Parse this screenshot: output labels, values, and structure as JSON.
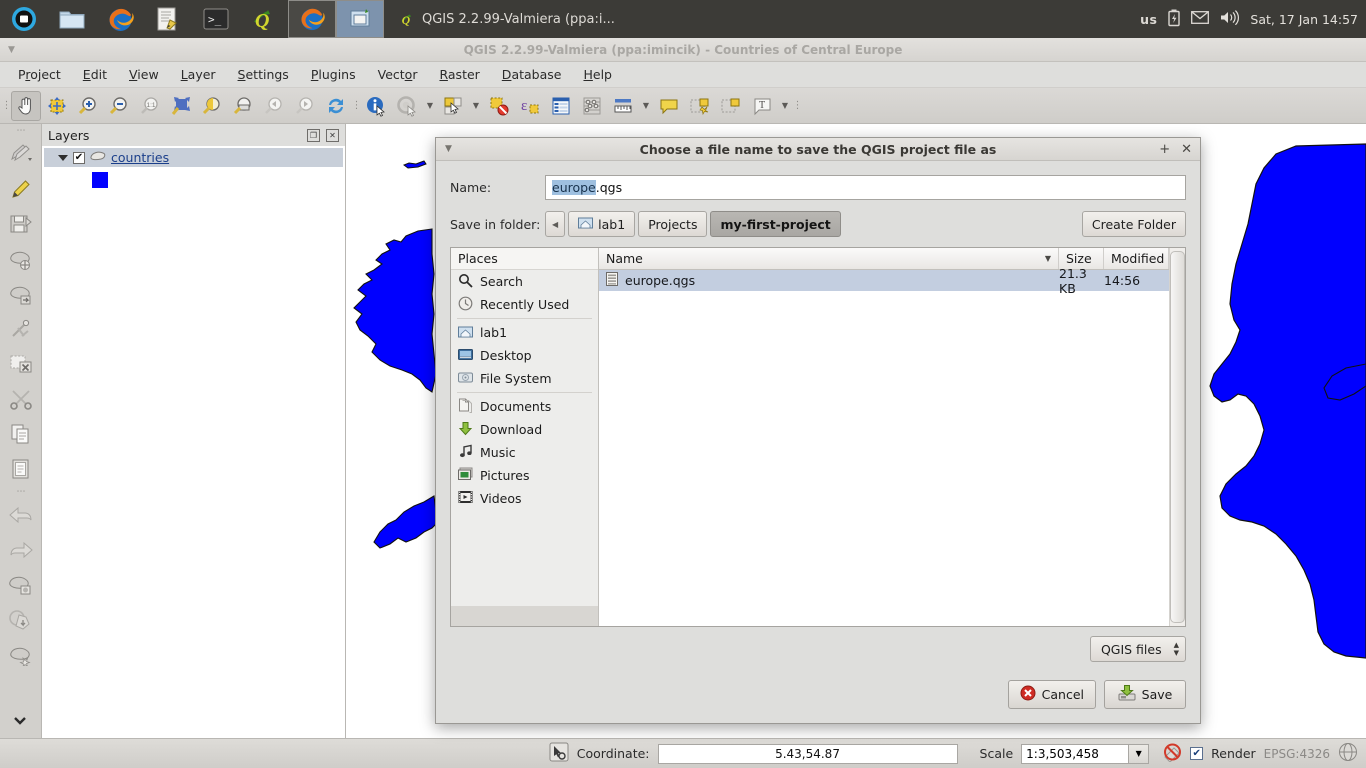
{
  "desktop": {
    "launcher": [
      {
        "name": "ubuntu-dash-icon",
        "label": "Dash home"
      },
      {
        "name": "files-icon",
        "label": "Files"
      },
      {
        "name": "firefox-icon",
        "label": "Firefox Web Browser"
      },
      {
        "name": "text-editor-icon",
        "label": "Text Editor"
      },
      {
        "name": "terminal-icon",
        "label": "Terminal"
      },
      {
        "name": "qgis-icon",
        "label": "QGIS Desktop"
      },
      {
        "name": "firefox-window-icon",
        "label": "Firefox"
      },
      {
        "name": "qgis-window-icon",
        "label": "QGIS window"
      }
    ],
    "app_title": "QGIS 2.2.99-Valmiera (ppa:i...",
    "tray": {
      "keyboard_layout": "us",
      "battery_icon": "battery-icon",
      "mail_icon": "mail-icon",
      "volume_icon": "volume-icon",
      "clock": "Sat, 17 Jan  14:57"
    }
  },
  "window": {
    "title": "QGIS 2.2.99-Valmiera (ppa:imincik) - Countries of Central Europe",
    "menu": [
      {
        "label": "Project",
        "mnemonic": "r"
      },
      {
        "label": "Edit",
        "mnemonic": "E"
      },
      {
        "label": "View",
        "mnemonic": "V"
      },
      {
        "label": "Layer",
        "mnemonic": "L"
      },
      {
        "label": "Settings",
        "mnemonic": "S"
      },
      {
        "label": "Plugins",
        "mnemonic": "P"
      },
      {
        "label": "Vector",
        "mnemonic": "o"
      },
      {
        "label": "Raster",
        "mnemonic": "R"
      },
      {
        "label": "Database",
        "mnemonic": "D"
      },
      {
        "label": "Help",
        "mnemonic": "H"
      }
    ],
    "toolbar": [
      {
        "name": "pan-map-tool",
        "pressed": true
      },
      {
        "name": "pan-to-selection-tool",
        "pressed": false
      },
      {
        "name": "zoom-in-tool",
        "pressed": false
      },
      {
        "name": "zoom-out-tool",
        "pressed": false
      },
      {
        "name": "zoom-native-resolution-tool",
        "pressed": false
      },
      {
        "name": "zoom-full-tool",
        "pressed": false
      },
      {
        "name": "zoom-to-selection-tool",
        "pressed": false
      },
      {
        "name": "zoom-to-layer-tool",
        "pressed": false
      },
      {
        "name": "zoom-last-tool",
        "pressed": false
      },
      {
        "name": "zoom-next-tool",
        "pressed": false
      },
      {
        "name": "refresh-tool",
        "pressed": false
      },
      {
        "name": "identify-features-tool",
        "pressed": false
      },
      {
        "name": "map-tips-tool",
        "pressed": false
      },
      {
        "name": "select-features-tool",
        "pressed": false
      },
      {
        "name": "deselect-features-tool",
        "pressed": false
      },
      {
        "name": "field-calculator-tool",
        "pressed": false
      },
      {
        "name": "open-attribute-table-tool",
        "pressed": false
      },
      {
        "name": "statistics-tool",
        "pressed": false
      },
      {
        "name": "measure-line-tool",
        "pressed": false
      },
      {
        "name": "new-annotation-tool",
        "pressed": false
      },
      {
        "name": "add-form-annotation-tool",
        "pressed": false
      },
      {
        "name": "add-html-annotation-tool",
        "pressed": false
      },
      {
        "name": "text-annotation-tool",
        "pressed": false
      }
    ],
    "vtoolbar": [
      {
        "name": "pencils-icon"
      },
      {
        "name": "toggle-editing-icon"
      },
      {
        "name": "save-layer-edits-icon"
      },
      {
        "name": "add-feature-icon"
      },
      {
        "name": "move-feature-icon"
      },
      {
        "name": "node-tool-icon"
      },
      {
        "name": "delete-selected-icon"
      },
      {
        "name": "cut-features-icon"
      },
      {
        "name": "copy-features-icon"
      },
      {
        "name": "paste-features-icon"
      },
      {
        "name": "undo-icon"
      },
      {
        "name": "redo-icon"
      },
      {
        "name": "rotate-point-symbols-icon"
      },
      {
        "name": "simplify-feature-icon"
      },
      {
        "name": "add-part-icon"
      },
      {
        "name": "overflow-chevron-icon"
      }
    ]
  },
  "layers_panel": {
    "title": "Layers",
    "undock_icon": "undock-icon",
    "close_icon": "close-icon",
    "items": [
      {
        "name": "countries",
        "checked": true,
        "expanded": true,
        "symbol_color": "#0000ff"
      }
    ]
  },
  "statusbar": {
    "coordinate_icon": "coordinate-capture-icon",
    "coordinate_label": "Coordinate:",
    "coordinate_value": "5.43,54.87",
    "scale_label": "Scale",
    "scale_value": "1:3,503,458",
    "render_blocked_icon": "render-blocked-icon",
    "render_label": "Render",
    "render_checked": true,
    "epsg": "EPSG:4326",
    "crs_icon": "crs-status-icon"
  },
  "dialog": {
    "title": "Choose a file name to save the QGIS project file as",
    "maximize_icon": "maximize-icon",
    "close_icon": "close-icon",
    "name_label": "Name:",
    "name_value_selected": "europe",
    "name_value_rest": ".qgs",
    "folder_label": "Save in folder:",
    "breadcrumb_back_icon": "breadcrumb-back-icon",
    "breadcrumb": [
      {
        "label": "lab1",
        "icon": "home-folder-icon",
        "current": false
      },
      {
        "label": "Projects",
        "icon": "",
        "current": false
      },
      {
        "label": "my-first-project",
        "icon": "",
        "current": true
      }
    ],
    "create_folder_label": "Create Folder",
    "places_title": "Places",
    "places": [
      {
        "label": "Search",
        "icon": "search-icon"
      },
      {
        "label": "Recently Used",
        "icon": "recent-icon"
      },
      {
        "separator": true
      },
      {
        "label": "lab1",
        "icon": "home-folder-icon"
      },
      {
        "label": "Desktop",
        "icon": "desktop-icon"
      },
      {
        "label": "File System",
        "icon": "drive-icon"
      },
      {
        "separator": true
      },
      {
        "label": "Documents",
        "icon": "documents-icon"
      },
      {
        "label": "Download",
        "icon": "download-icon"
      },
      {
        "label": "Music",
        "icon": "music-icon"
      },
      {
        "label": "Pictures",
        "icon": "pictures-icon"
      },
      {
        "label": "Videos",
        "icon": "videos-icon"
      }
    ],
    "columns": [
      "Name",
      "Size",
      "Modified"
    ],
    "files": [
      {
        "name": "europe.qgs",
        "size": "21.3 KB",
        "modified": "14:56",
        "selected": true,
        "icon": "file-icon"
      }
    ],
    "filter_value": "QGIS files",
    "cancel_label": "Cancel",
    "save_label": "Save"
  }
}
